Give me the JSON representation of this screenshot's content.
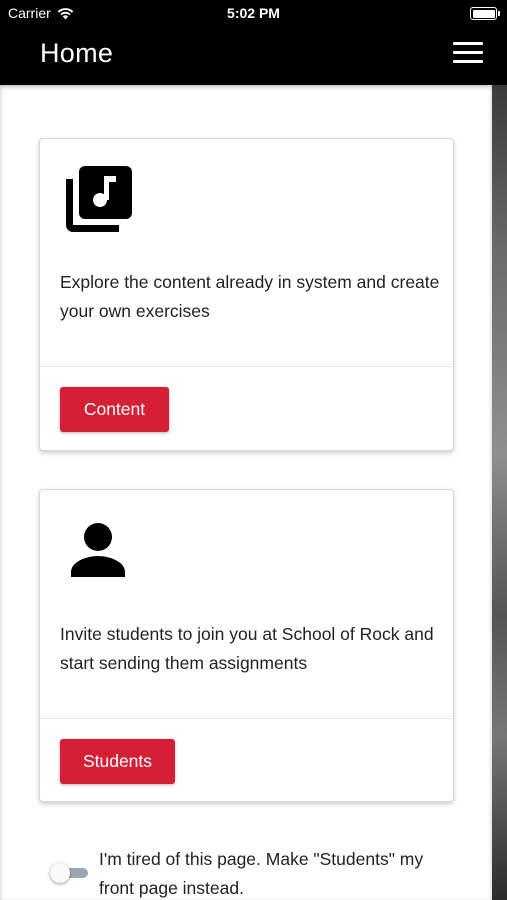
{
  "status_bar": {
    "carrier": "Carrier",
    "time": "5:02 PM",
    "wifi_icon": "wifi-icon",
    "battery_icon": "battery-icon"
  },
  "navbar": {
    "title": "Home",
    "menu_icon": "hamburger-menu-icon"
  },
  "cards": [
    {
      "icon": "music-library-icon",
      "description": "Explore the content already in system and create your own exercises",
      "button_label": "Content"
    },
    {
      "icon": "person-icon",
      "description": "Invite students to join you at School of Rock and start sending them assignments",
      "button_label": "Students"
    }
  ],
  "front_page_toggle": {
    "label": "I'm tired of this page. Make \"Students\" my front page instead.",
    "checked": false
  },
  "colors": {
    "header_bg": "#000000",
    "button_red": "#d41f35",
    "toggle_track": "#9aa6b0"
  }
}
